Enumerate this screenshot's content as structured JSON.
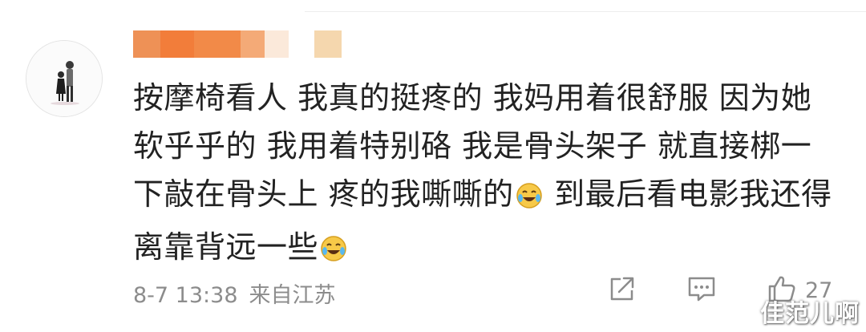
{
  "comment": {
    "username": "",
    "username_mask_colors": [
      "#ee9156",
      "#f27d3a",
      "#f4aa77",
      "#fbe9da",
      "#f5d7ae"
    ],
    "text": [
      "按摩椅看人 我真的挺疼的 我妈用着很舒服 因为她软乎乎的 我用着特别硌 我是骨头架子 就直接梆一下敲在骨头上 疼的我嘶嘶的",
      " 到最后看电影我还得离靠背远一些"
    ],
    "emoji_names": [
      "laugh-cry-emoji",
      "laugh-cry-emoji"
    ],
    "date_time": "8-7 13:38",
    "source": "来自江苏",
    "like_count": "27",
    "watermark": "佳范儿啊"
  },
  "icons": {
    "share": "share-icon",
    "comment": "comment-icon",
    "like": "thumbs-up-icon"
  },
  "colors": {
    "text": "#222222",
    "meta": "#8c8c8c",
    "emoji_face": "#f7c948"
  }
}
